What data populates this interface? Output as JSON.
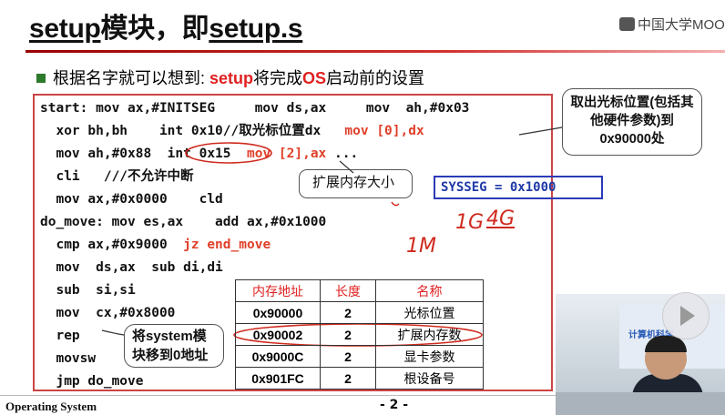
{
  "title": {
    "part1": "setup",
    "part2": "模块，即",
    "part3": "setup.s"
  },
  "logo": "中国大学MOOC",
  "bullet": {
    "text1": "根据名字就可以想到: ",
    "highlight": "setup",
    "text2": "将完成",
    "os": "OS",
    "text3": "启动前的设置"
  },
  "code": {
    "l1": "start: mov ax,#INITSEG     mov ds,ax     mov  ah,#0x03",
    "l2a": "  xor bh,bh    int 0x10//取光标位置dx   ",
    "l2b": "mov [0],dx",
    "l3a": "  mov ah,#0x88  int 0x15  ",
    "l3b": "mov [2],ax",
    "l3c": " ...",
    "l4": "  cli   ///不允许中断",
    "l5": "  mov ax,#0x0000    cld",
    "l6": "do_move: mov es,ax    add ax,#0x1000",
    "l7a": "  cmp ax,#0x9000  ",
    "l7b": "jz end_move",
    "l8": "  mov  ds,ax  sub di,di",
    "l9": "  sub  si,si",
    "l10": "  mov  cx,#0x8000",
    "l11": "  rep",
    "l12": "  movsw",
    "l13": "  jmp do_move"
  },
  "callouts": {
    "cursor": "取出光标位置(包括其他硬件参数)到0x90000处",
    "extended": "扩展内存大小",
    "move": "将system模块移到0地址",
    "sysseg": "SYSSEG = 0x1000"
  },
  "handwriting": {
    "a": "1G",
    "b": "4G",
    "c": "1M"
  },
  "table": {
    "headers": [
      "内存地址",
      "长度",
      "名称"
    ],
    "rows": [
      [
        "0x90000",
        "2",
        "光标位置"
      ],
      [
        "0x90002",
        "2",
        "扩展内存数"
      ],
      [
        "0x9000C",
        "2",
        "显卡参数"
      ],
      [
        "0x901FC",
        "2",
        "根设备号"
      ]
    ]
  },
  "footer": {
    "left": "Operating System",
    "page": "- 2 -"
  },
  "video": {
    "board_text": "计算机科学"
  },
  "colors": {
    "accent_red": "#e02020",
    "code_red": "#e0402a",
    "sysseg_blue": "#1f3aa8",
    "bullet_green": "#2d7a2d"
  }
}
